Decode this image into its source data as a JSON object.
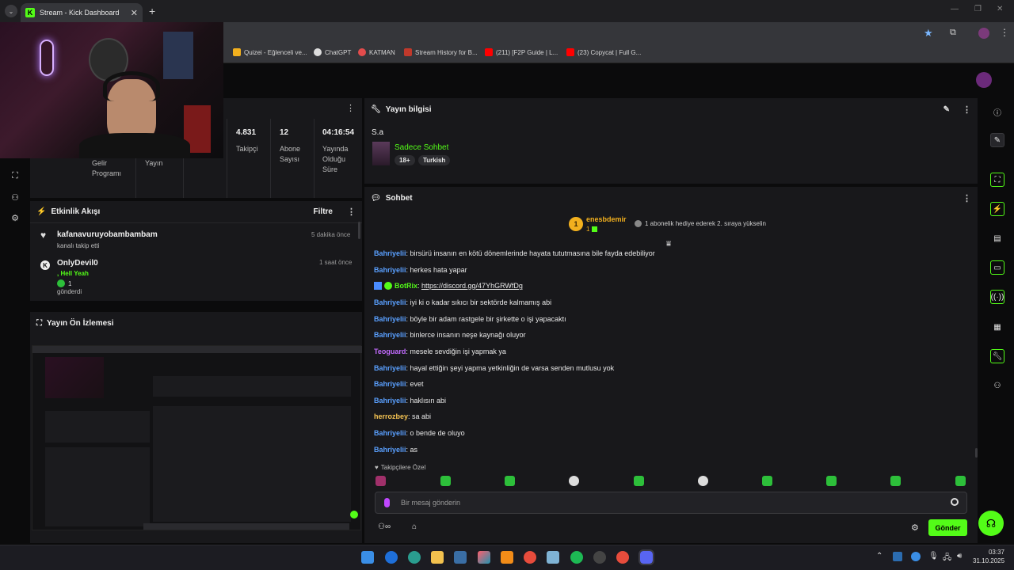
{
  "browser": {
    "tab_title": "Stream - Kick Dashboard",
    "tab_icon": "K",
    "new_tab": "+",
    "bookmarks": [
      {
        "label": "Quizei - Eğlenceli ve...",
        "color": "#f2b01e"
      },
      {
        "label": "ChatGPT",
        "color": "#dddddd"
      },
      {
        "label": "KATMAN",
        "color": "#e34c4c"
      },
      {
        "label": "Stream History for B...",
        "color": "#c0392b"
      },
      {
        "label": "(211) [F2P Guide | L...",
        "color": "#ff0000"
      },
      {
        "label": "(23) Copycat | Full G...",
        "color": "#ff0000"
      }
    ]
  },
  "stats": [
    {
      "value": "",
      "label": "Gelir Programı"
    },
    {
      "value": "",
      "label": "Yayın"
    },
    {
      "value": "4.831",
      "label": "Takipçi"
    },
    {
      "value": "12",
      "label": "Abone Sayısı"
    },
    {
      "value": "04:16:54",
      "label": "Yayında Olduğu Süre"
    }
  ],
  "activity": {
    "title": "Etkinlik Akışı",
    "filter": "Filtre",
    "items": [
      {
        "name": "kafanavuruyobambambam",
        "sub": "kanalı takip etti",
        "time": "5 dakika önce"
      },
      {
        "name": "OnlyDevil0",
        "sub_highlight": ", Hell Yeah",
        "count": "1",
        "sub": "gönderdi",
        "time": "1 saat önce"
      }
    ]
  },
  "preview": {
    "title": "Yayın Ön İzlemesi"
  },
  "stream_info": {
    "title": "Yayın bilgisi",
    "stream_title": "S.a",
    "category": "Sadece Sohbet",
    "tags": [
      "18+",
      "Turkish"
    ]
  },
  "chat": {
    "title": "Sohbet",
    "pinned_user": "enesbdemir",
    "pinned_rank": "1",
    "pinned_count": "1",
    "gift_note": "1 abonelik hediye ederek 2. sıraya yükselin",
    "messages": [
      {
        "user": "Bahriyelii",
        "color": "#5aa0ff",
        "text": ": birsürü insanın en kötü dönemlerinde hayata tututmasına bile fayda edebiliyor"
      },
      {
        "user": "Bahriyelii",
        "color": "#5aa0ff",
        "text": ": herkes hata yapar"
      },
      {
        "user": "BotRix",
        "color": "#53fc18",
        "text": ": ",
        "link": "https://discord.gg/47YhGRWfDg"
      },
      {
        "user": "Bahriyelii",
        "color": "#5aa0ff",
        "text": ": iyi ki o kadar sıkıcı bir sektörde kalmamış abi"
      },
      {
        "user": "Bahriyelii",
        "color": "#5aa0ff",
        "text": ": böyle bir adam rastgele bir şirkette o işi yapacaktı"
      },
      {
        "user": "Bahriyelii",
        "color": "#5aa0ff",
        "text": ": binlerce insanın neşe kaynağı oluyor"
      },
      {
        "user": "Teoguard",
        "color": "#c36bff",
        "text": ": mesele sevdiğin işi yapmak ya"
      },
      {
        "user": "Bahriyelii",
        "color": "#5aa0ff",
        "text": ": hayal ettiğin şeyi yapma yetkinliğin de varsa senden mutlusu yok"
      },
      {
        "user": "Bahriyelii",
        "color": "#5aa0ff",
        "text": ": evet"
      },
      {
        "user": "Bahriyelii",
        "color": "#5aa0ff",
        "text": ": haklısın abi"
      },
      {
        "user": "herrozbey",
        "color": "#f6c453",
        "text": ": sa abi"
      },
      {
        "user": "Bahriyelii",
        "color": "#5aa0ff",
        "text": ": o bende de oluyo"
      },
      {
        "user": "Bahriyelii",
        "color": "#5aa0ff",
        "text": ": as"
      }
    ],
    "followers_only": "Takipçilere Özel",
    "input_placeholder": "Bir mesaj gönderin",
    "send_label": "Gönder"
  },
  "taskbar": {
    "time": "03:37",
    "date": "31.10.2025"
  }
}
